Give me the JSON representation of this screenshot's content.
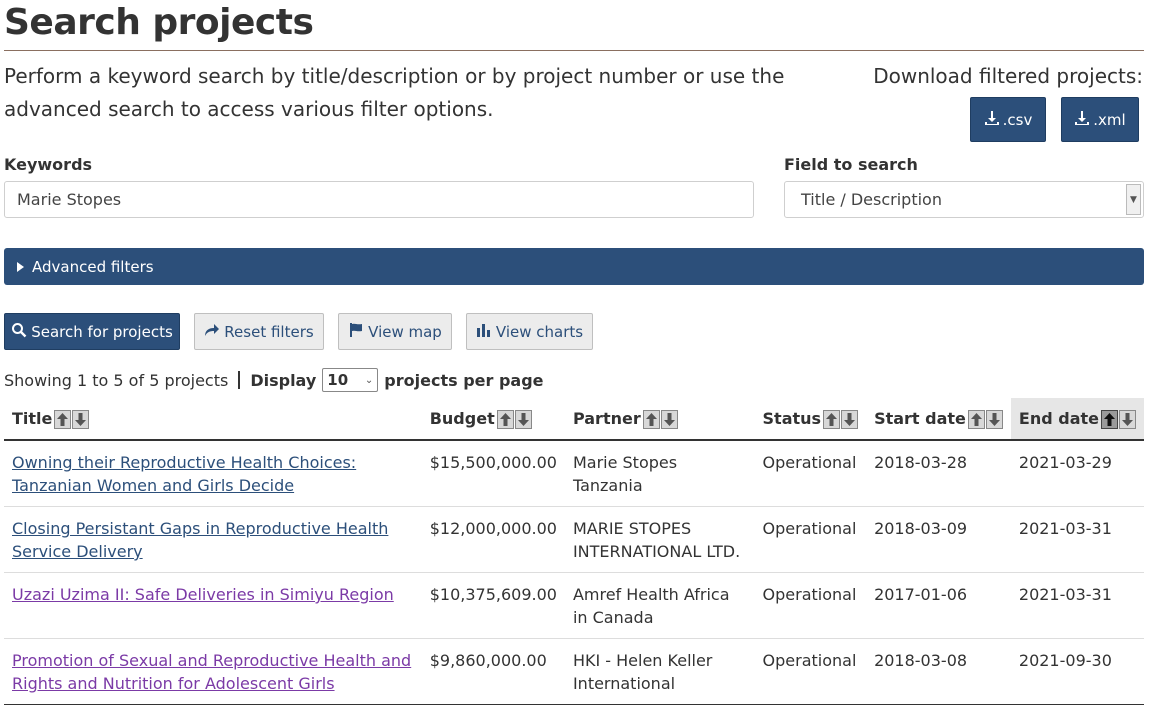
{
  "page_title": "Search projects",
  "intro_text": "Perform a keyword search by title/description or by project number or use the advanced search to access various filter options.",
  "download": {
    "label": "Download filtered projects:",
    "csv_label": ".csv",
    "xml_label": ".xml"
  },
  "keywords": {
    "label": "Keywords",
    "value": "Marie Stopes"
  },
  "field_to_search": {
    "label": "Field to search",
    "selected": "Title / Description"
  },
  "advanced_filters_label": "Advanced filters",
  "actions": {
    "search": "Search for projects",
    "reset": "Reset filters",
    "map": "View map",
    "charts": "View charts"
  },
  "pagination": {
    "showing": "Showing 1 to 5 of 5 projects",
    "display_label": "Display",
    "per_page_value": "10",
    "per_page_suffix": "projects per page"
  },
  "table": {
    "columns": [
      "Title",
      "Budget",
      "Partner",
      "Status",
      "Start date",
      "End date"
    ],
    "rows": [
      {
        "title": "Owning their Reproductive Health Choices: Tanzanian Women and Girls Decide",
        "budget": "$15,500,000.00",
        "partner": "Marie Stopes Tanzania",
        "status": "Operational",
        "start": "2018-03-28",
        "end": "2021-03-29",
        "visited": false
      },
      {
        "title": "Closing Persistant Gaps in Reproductive Health Service Delivery",
        "budget": "$12,000,000.00",
        "partner": "MARIE STOPES INTERNATIONAL LTD.",
        "status": "Operational",
        "start": "2018-03-09",
        "end": "2021-03-31",
        "visited": false
      },
      {
        "title": "Uzazi Uzima II: Safe Deliveries in Simiyu Region",
        "budget": "$10,375,609.00",
        "partner": "Amref Health Africa in Canada",
        "status": "Operational",
        "start": "2017-01-06",
        "end": "2021-03-31",
        "visited": true
      },
      {
        "title": "Promotion of Sexual and Reproductive Health and Rights and Nutrition for Adolescent Girls",
        "budget": "$9,860,000.00",
        "partner": "HKI - Helen Keller International",
        "status": "Operational",
        "start": "2018-03-08",
        "end": "2021-09-30",
        "visited": true
      }
    ]
  },
  "colors": {
    "primary": "#2c4f7a",
    "link": "#2c4f7a",
    "visited_link": "#7b3aa6"
  }
}
